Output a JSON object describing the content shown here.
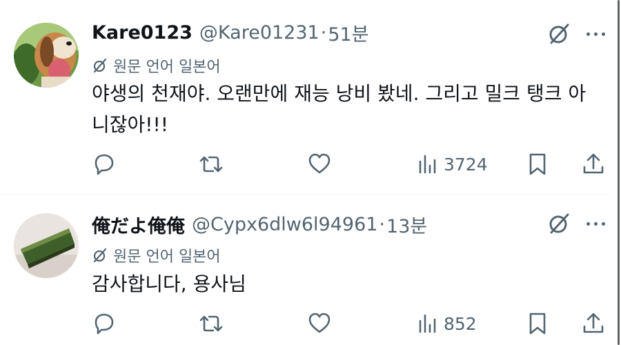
{
  "tweets": [
    {
      "display_name": "Kare0123",
      "handle": "@Kare01231",
      "separator": "·",
      "time": "51분",
      "translate_label": "원문 언어 일본어",
      "text": "야생의 천재야. 오랜만에 재능 낭비 봤네. 그리고 밀크 탱크 아니잖아!!!",
      "views": "3724"
    },
    {
      "display_name": "俺だよ俺俺",
      "handle": "@Cypx6dlw6l94961",
      "separator": "·",
      "time": "13분",
      "translate_label": "원문 언어 일본어",
      "text": "감사합니다, 용사님",
      "views": "852"
    }
  ],
  "icons": {
    "grok": "grok-icon",
    "more": "more-icon",
    "reply": "reply-icon",
    "retweet": "retweet-icon",
    "like": "like-icon",
    "views": "views-icon",
    "bookmark": "bookmark-icon",
    "share": "share-icon"
  },
  "colors": {
    "text_primary": "#0f1419",
    "text_secondary": "#536471",
    "divider": "#eff3f4"
  }
}
